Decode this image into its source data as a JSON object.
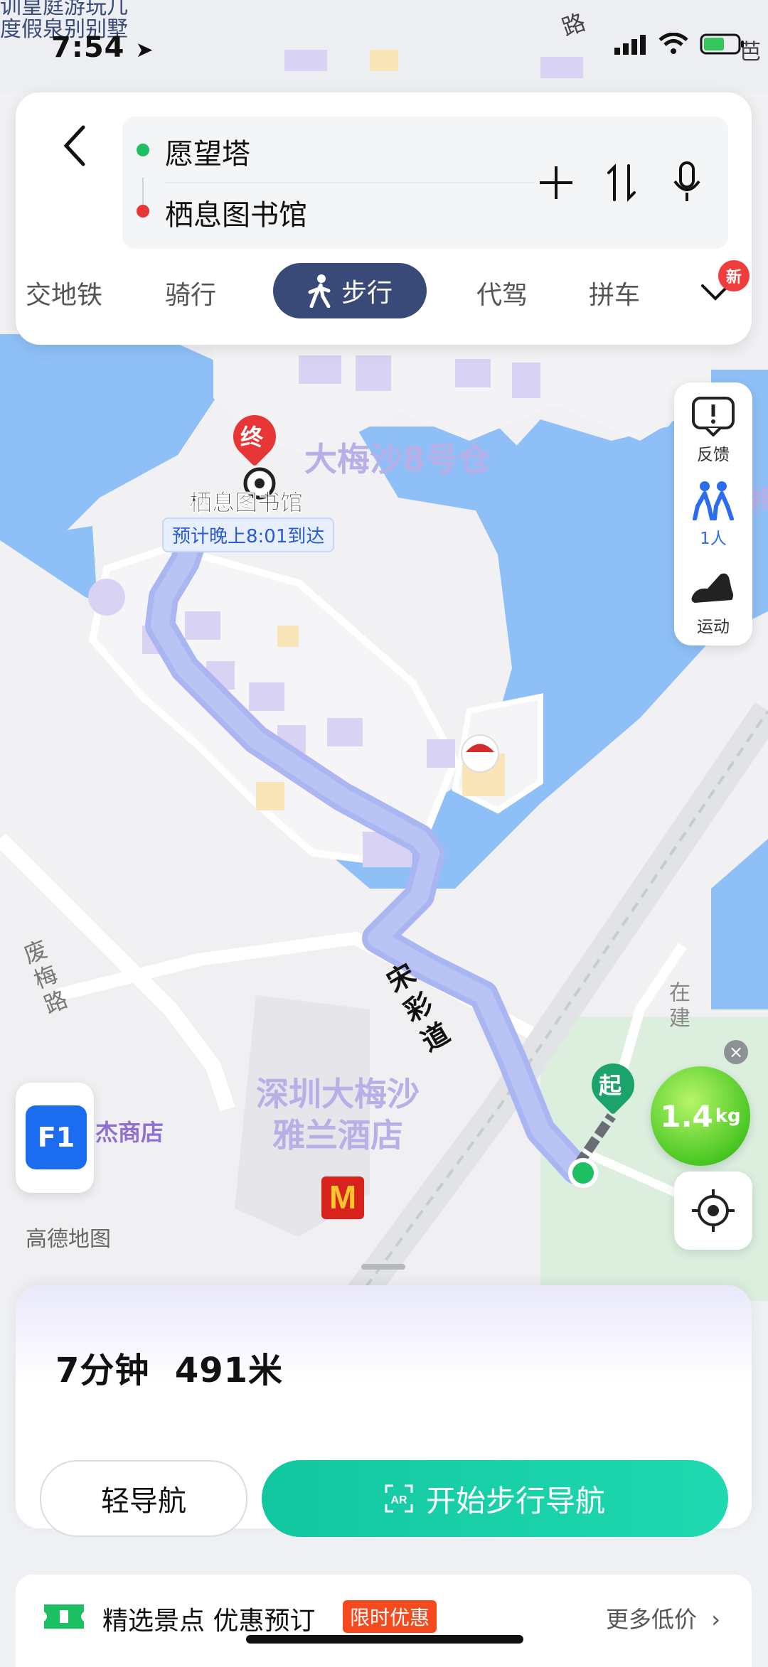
{
  "status_bar": {
    "time": "7:54"
  },
  "map": {
    "top_left_labels": [
      "训皇庭游玩几",
      "度假泉别别墅"
    ],
    "top_road": "路",
    "top_right": "芭",
    "destination_marker": "终",
    "destination_name": "栖息图书馆",
    "eta": "预计晚上8:01到达",
    "poi_warehouse": "大梅沙8号仓",
    "right_edge_poi": "梅",
    "road_song": "宋彩道",
    "road_left": "废梅路",
    "under_construction": "在建",
    "hotel": "深圳大梅沙雅兰酒店",
    "shop": "杰商店",
    "start_marker": "起",
    "watermark": "高德地图"
  },
  "route": {
    "from": "愿望塔",
    "to": "栖息图书馆"
  },
  "modes": {
    "items": [
      "交地铁",
      "骑行",
      "步行",
      "代驾",
      "拼车"
    ],
    "active": "步行",
    "badge": "新"
  },
  "side_panel": {
    "feedback": "反馈",
    "people": "1人",
    "sport": "运动"
  },
  "floor_button": "F1",
  "carbon": {
    "value": "1.4",
    "unit": "kg"
  },
  "summary": {
    "time": "7分钟",
    "distance": "491米"
  },
  "buttons": {
    "light_nav": "轻导航",
    "start_nav": "开始步行导航"
  },
  "promo": {
    "title": "精选景点 优惠预订",
    "badge": "限时优惠",
    "more": "更多低价"
  },
  "colors": {
    "active_mode": "#3a4a78",
    "start_nav": "#12c7a0",
    "route": "#a9b6f2",
    "water": "#8ec0f7",
    "origin_dot": "#1dbf63",
    "destination_dot": "#e83535"
  }
}
